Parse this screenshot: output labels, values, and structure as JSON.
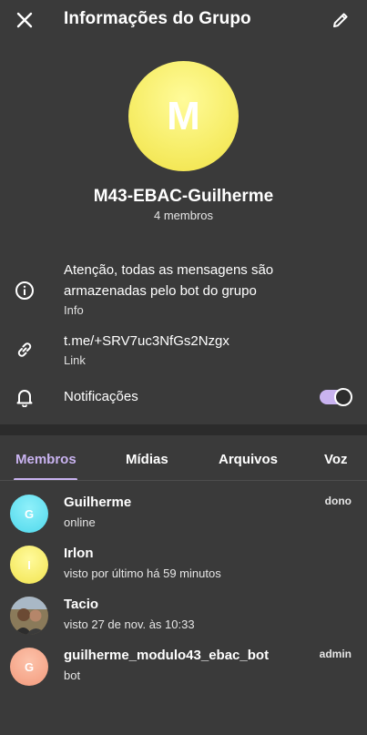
{
  "header": {
    "title": "Informações do Grupo",
    "close_icon": "close-icon",
    "edit_icon": "pencil-icon"
  },
  "group": {
    "avatar_letter": "M",
    "name": "M43-EBAC-Guilherme",
    "member_count": "4 membros"
  },
  "info": {
    "description": "Atenção, todas as mensagens são armazenadas pelo bot do grupo",
    "description_line1": "Atenção, todas as mensagens são",
    "description_line2": "armazenadas pelo bot do grupo",
    "description_label": "Info",
    "link": "t.me/+SRV7uc3NfGs2Nzgx",
    "link_label": "Link",
    "notifications_label": "Notificações",
    "notifications_enabled": true
  },
  "tabs": [
    {
      "label": "Membros",
      "active": true
    },
    {
      "label": "Mídias",
      "active": false
    },
    {
      "label": "Arquivos",
      "active": false
    },
    {
      "label": "Voz",
      "active": false
    }
  ],
  "members": [
    {
      "initial": "G",
      "name": "Guilherme",
      "status": "online",
      "role": "dono",
      "color": "#5ee0f0"
    },
    {
      "initial": "I",
      "name": "Irlon",
      "status": "visto por último há 59 minutos",
      "role": "",
      "color": "#f6ee6a"
    },
    {
      "initial": "",
      "name": "Tacio",
      "status": "visto 27 de nov. às 10:33",
      "role": "",
      "color": "#6b5a44"
    },
    {
      "initial": "G",
      "name": "guilherme_modulo43_ebac_bot",
      "status": "bot",
      "role": "admin",
      "color": "#f4a98c"
    }
  ],
  "colors": {
    "background": "#3a3a3a",
    "accent": "#c9b3f0",
    "divider": "#2b2b2b"
  }
}
